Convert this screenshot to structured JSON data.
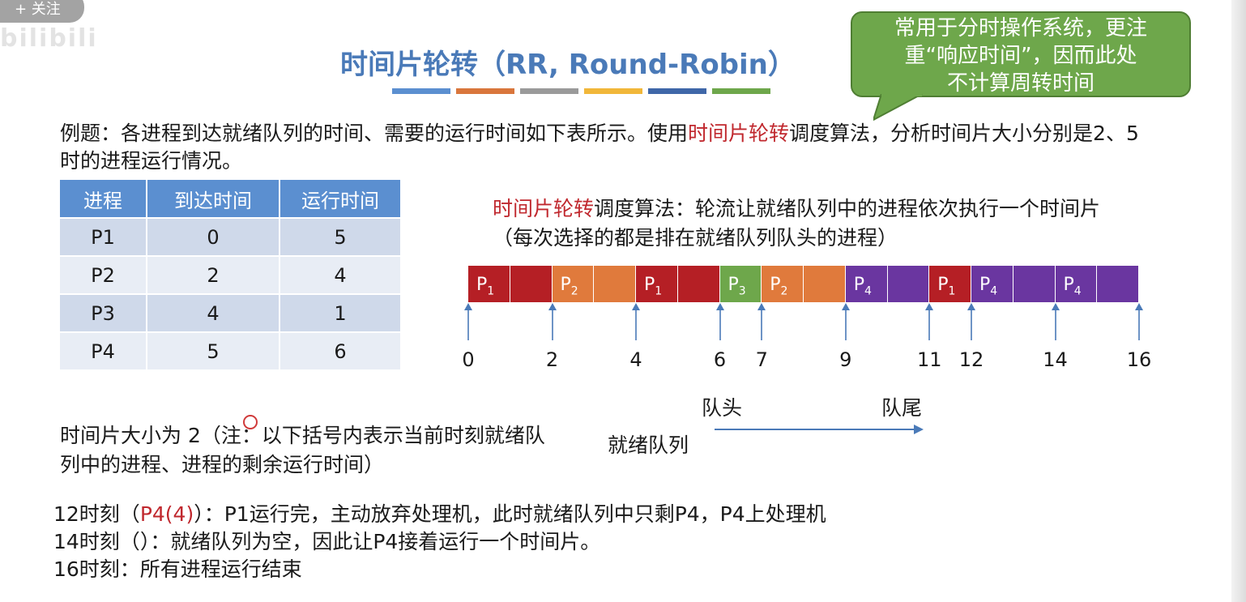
{
  "overlay": {
    "follow_button": "+ 关注"
  },
  "title": "时间片轮转（RR, Round-Robin）",
  "title_bar_colors": [
    "#5b8fd0",
    "#d9763c",
    "#9a9a9a",
    "#f1b73a",
    "#3f67a8",
    "#6ea74b"
  ],
  "callout": {
    "lines": [
      "常用于分时操作系统，更注",
      "重“响应时间”，因而此处",
      "不计算周转时间"
    ],
    "color": "#6ea74b"
  },
  "problem": {
    "prefix": "例题：各进程到达就绪队列的时间、需要的运行时间如下表所示。使用",
    "highlight": "时间片轮转",
    "suffix": "调度算法，分析时间片大小分别是2、5时的进程运行情况。"
  },
  "table": {
    "headers": [
      "进程",
      "到达时间",
      "运行时间"
    ],
    "rows": [
      [
        "P1",
        "0",
        "5"
      ],
      [
        "P2",
        "2",
        "4"
      ],
      [
        "P3",
        "4",
        "1"
      ],
      [
        "P4",
        "5",
        "6"
      ]
    ]
  },
  "rr_desc": {
    "highlight": "时间片轮转",
    "text": "调度算法：轮流让就绪队列中的进程依次执行一个时间片（每次选择的都是排在就绪队列队头的进程）"
  },
  "gantt": {
    "start": 0,
    "end": 16,
    "segments": [
      {
        "label": "P",
        "sub": "1",
        "start": 0,
        "end": 1,
        "color": "#b51f25"
      },
      {
        "label": "",
        "sub": "",
        "start": 1,
        "end": 2,
        "color": "#b51f25"
      },
      {
        "label": "P",
        "sub": "2",
        "start": 2,
        "end": 3,
        "color": "#e07a3c"
      },
      {
        "label": "",
        "sub": "",
        "start": 3,
        "end": 4,
        "color": "#e07a3c"
      },
      {
        "label": "P",
        "sub": "1",
        "start": 4,
        "end": 5,
        "color": "#b51f25"
      },
      {
        "label": "",
        "sub": "",
        "start": 5,
        "end": 6,
        "color": "#b51f25"
      },
      {
        "label": "P",
        "sub": "3",
        "start": 6,
        "end": 7,
        "color": "#6ea74b"
      },
      {
        "label": "P",
        "sub": "2",
        "start": 7,
        "end": 8,
        "color": "#e07a3c"
      },
      {
        "label": "",
        "sub": "",
        "start": 8,
        "end": 9,
        "color": "#e07a3c"
      },
      {
        "label": "P",
        "sub": "4",
        "start": 9,
        "end": 10,
        "color": "#6a36a0"
      },
      {
        "label": "",
        "sub": "",
        "start": 10,
        "end": 11,
        "color": "#6a36a0"
      },
      {
        "label": "P",
        "sub": "1",
        "start": 11,
        "end": 12,
        "color": "#b51f25"
      },
      {
        "label": "P",
        "sub": "4",
        "start": 12,
        "end": 13,
        "color": "#6a36a0"
      },
      {
        "label": "",
        "sub": "",
        "start": 13,
        "end": 14,
        "color": "#6a36a0"
      },
      {
        "label": "P",
        "sub": "4",
        "start": 14,
        "end": 15,
        "color": "#6a36a0"
      },
      {
        "label": "",
        "sub": "",
        "start": 15,
        "end": 16,
        "color": "#6a36a0"
      }
    ],
    "ticks": [
      0,
      2,
      4,
      6,
      7,
      9,
      11,
      12,
      14,
      16
    ]
  },
  "queue": {
    "head": "队头",
    "tail": "队尾",
    "label": "就绪队列"
  },
  "slice_note": {
    "prefix": "时间片大小为 2（",
    "text": "注：以下括号内表示当前时刻就绪队列中的进程、进程的剩余运行时间）"
  },
  "events": [
    {
      "time": "12时刻（",
      "highlight": "P4(4)",
      "rest": "）：P1运行完，主动放弃处理机，此时就绪队列中只剩P4，P4上处理机"
    },
    {
      "time": "14时刻（",
      "highlight": "",
      "rest": "）：就绪队列为空，因此让P4接着运行一个时间片。"
    },
    {
      "time": "16时刻：所有进程运行结束",
      "highlight": "",
      "rest": ""
    }
  ]
}
